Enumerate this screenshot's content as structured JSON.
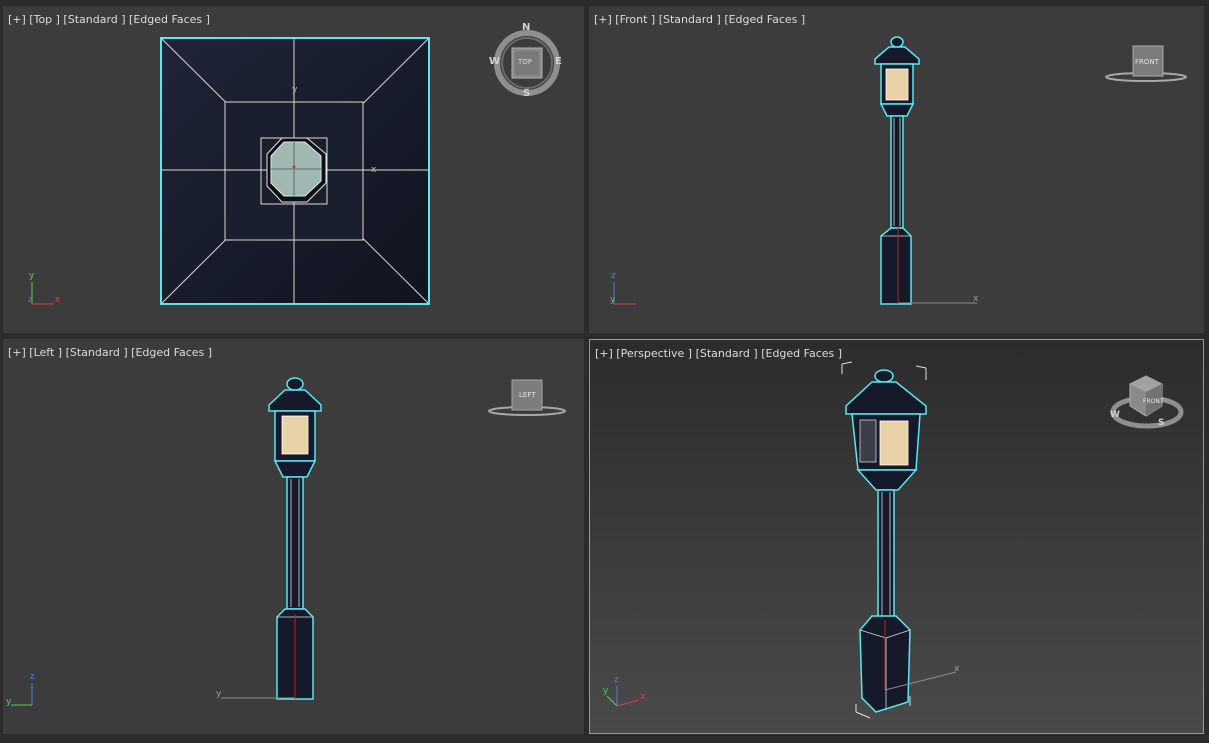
{
  "viewports": {
    "top": {
      "label": "[+] [Top ] [Standard ] [Edged Faces ]",
      "cube_face": "TOP",
      "compass": {
        "n": "N",
        "s": "S",
        "e": "E",
        "w": "W"
      },
      "axes": {
        "a": "y",
        "b": "z",
        "c": "x"
      }
    },
    "front": {
      "label": "[+] [Front ] [Standard ] [Edged Faces ]",
      "cube_face": "FRONT",
      "axes": {
        "a": "z",
        "b": "y",
        "c": "x"
      }
    },
    "left": {
      "label": "[+] [Left ] [Standard ] [Edged Faces ]",
      "cube_face": "LEFT",
      "axes": {
        "a": "z",
        "b": "y",
        "c": "x"
      }
    },
    "perspective": {
      "label": "[+] [Perspective ] [Standard ] [Edged Faces ]",
      "cube_face": "FRONT",
      "compass": {
        "s": "S",
        "w": "W"
      },
      "axes": {
        "a": "z",
        "b": "y",
        "c": "x"
      }
    }
  },
  "colors": {
    "selection": "#58e8f0",
    "active_border": "#b49a3a",
    "lamp_glass": "#e9d2a6",
    "object_fill": "#15192a"
  }
}
